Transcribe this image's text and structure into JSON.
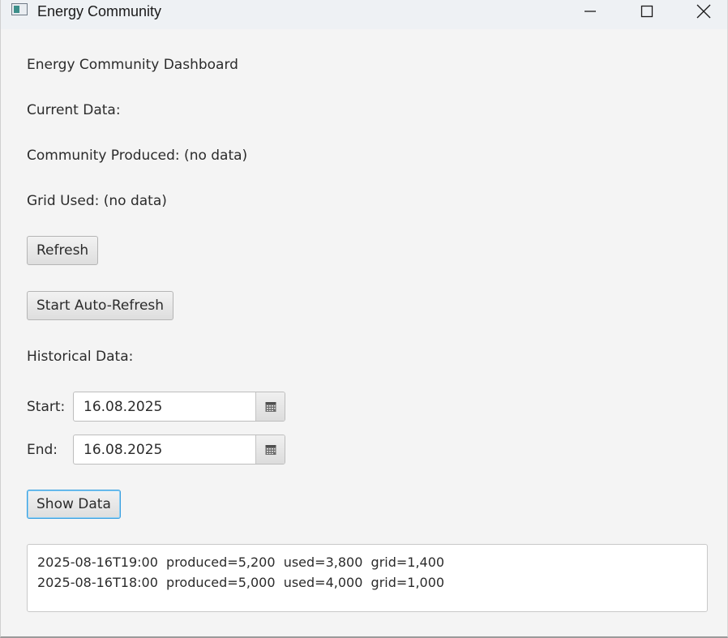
{
  "window": {
    "title": "Energy Community",
    "controls": {
      "minimize": "minimize-icon",
      "maximize": "maximize-icon",
      "close": "close-icon"
    }
  },
  "dashboard": {
    "heading": "Energy Community Dashboard",
    "current_label": "Current Data:",
    "community_produced": "Community Produced: (no data)",
    "grid_used": "Grid Used: (no data)",
    "refresh_label": "Refresh",
    "auto_refresh_label": "Start Auto-Refresh"
  },
  "historical": {
    "label": "Historical Data:",
    "start_label": "Start:",
    "start_value": "16.08.2025",
    "end_label": "End:",
    "end_value": "16.08.2025",
    "calendar_icon": "calendar-icon",
    "show_label": "Show Data"
  },
  "results": {
    "lines": [
      "2025-08-16T19:00  produced=5,200  used=3,800  grid=1,400",
      "2025-08-16T18:00  produced=5,000  used=4,000  grid=1,000"
    ]
  },
  "colors": {
    "focus_accent": "#3aa0e0",
    "background": "#f4f4f4"
  }
}
